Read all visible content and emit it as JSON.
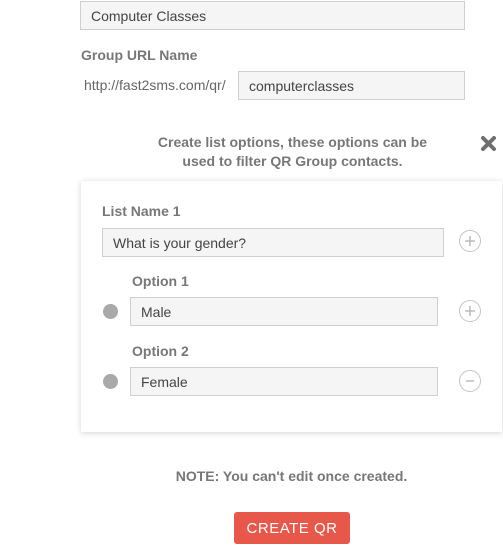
{
  "group_name": {
    "value": "Computer Classes"
  },
  "group_url": {
    "label": "Group URL Name",
    "prefix": "http://fast2sms.com/qr/",
    "value": "computerclasses"
  },
  "list_options": {
    "description_line1": "Create list options, these options can be",
    "description_line2": "used to filter QR Group contacts.",
    "close_icon": "close-icon",
    "list_name_label": "List Name 1",
    "list_name_value": "What is your gender?",
    "options": [
      {
        "label": "Option 1",
        "value": "Male",
        "action_icon": "plus-circle-icon"
      },
      {
        "label": "Option 2",
        "value": "Female",
        "action_icon": "minus-circle-icon"
      }
    ]
  },
  "note": "NOTE: You can't edit once created.",
  "create_button": {
    "label": "CREATE QR",
    "color": "#e8584a"
  }
}
